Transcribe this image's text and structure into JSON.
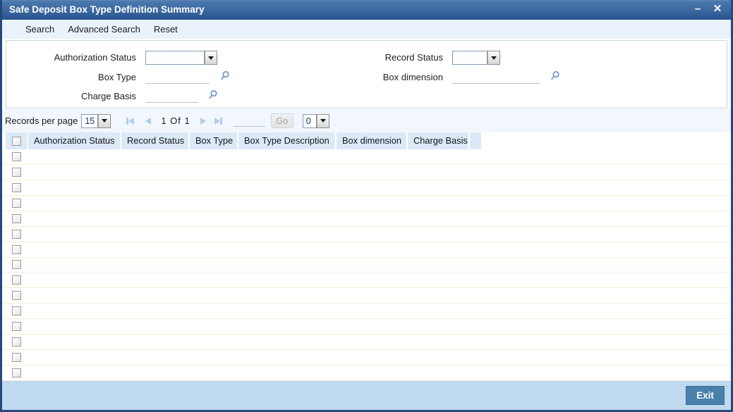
{
  "window": {
    "title": "Safe Deposit Box Type Definition Summary",
    "minimize_label": "–",
    "close_label": "✕"
  },
  "menu": {
    "items": [
      {
        "label": "Search"
      },
      {
        "label": "Advanced Search"
      },
      {
        "label": "Reset"
      }
    ]
  },
  "search_panel": {
    "authorization_status": {
      "label": "Authorization Status",
      "value": ""
    },
    "record_status": {
      "label": "Record Status",
      "value": ""
    },
    "box_type": {
      "label": "Box Type",
      "value": ""
    },
    "box_dimension": {
      "label": "Box dimension",
      "value": ""
    },
    "charge_basis": {
      "label": "Charge Basis",
      "value": ""
    }
  },
  "toolbar": {
    "records_per_page_label": "Records per page",
    "records_per_page_value": "15",
    "page_position": "1 Of 1",
    "page_jump_value": "",
    "go_label": "Go",
    "secondary_select_value": "0"
  },
  "table": {
    "headers": [
      "Authorization Status",
      "Record Status",
      "Box Type",
      "Box Type Description",
      "Box dimension",
      "Charge Basis"
    ],
    "row_count": 15,
    "rows": []
  },
  "footer": {
    "exit_label": "Exit"
  },
  "icons": {
    "search_icon": "magnifier",
    "pagination": [
      "first-page-icon",
      "previous-page-icon",
      "next-page-icon",
      "last-page-icon"
    ]
  },
  "colors": {
    "titlebar_top": "#4a78ad",
    "titlebar_bottom": "#28518f",
    "window_border": "#26497d",
    "menubar_bg": "#eaf2fb",
    "toolbar_bg": "#f2f7fd",
    "header_bg": "#dce9f7",
    "row_divider": "#f6ecd9",
    "footer_bg": "#bfd9ef",
    "exit_button_bg": "#4a80ac",
    "magnifier_blue": "#6f96c9",
    "pagination_arrow": "#b3cce8"
  }
}
